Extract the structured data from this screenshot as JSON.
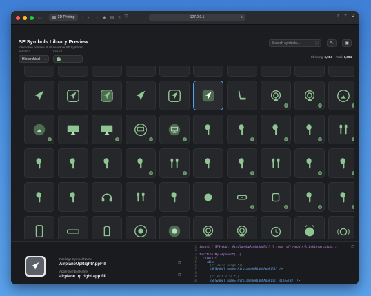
{
  "browser": {
    "tab_label": "3D Printing",
    "url": "127.0.0.1"
  },
  "app": {
    "title": "SF Symbols Library Preview",
    "subtitle": "Interactive preview of all available SF Symbols",
    "search_placeholder": "Search symbols...",
    "search_shortcut": "⌘K",
    "variant_label": "VARIANT",
    "variant_value": "Hierarchical",
    "color_label": "COLOR",
    "color_value": "#8fc592",
    "showing_label": "Showing:",
    "showing_count": "6,984",
    "total_label": "Total:",
    "total_count": "6,984"
  },
  "grid": {
    "rows": [
      [
        "airplane-icon",
        "airplane-circle-icon",
        "airplane-square-icon",
        "airplane-departure-icon",
        "airplane-arrival-icon",
        "airplane-tilt-icon",
        "airplane-tilt-icon",
        "airplane-tilt-icon",
        "airplane-tilt-icon",
        "airplane-tilt-icon"
      ],
      [
        "airplane-up-right-icon",
        "airplane-up-right-square-icon",
        "airplane-up-right-app-icon",
        "airplane-up-right-icon",
        "airplane-up-right-square-icon",
        "airplane-up-right-app-fill-icon",
        "seat-icon",
        "airplay-audio-icon",
        "airplay-audio-badge-icon",
        "airplay-audio-circle-icon"
      ],
      [
        "airplay-audio-circle-fill-icon",
        "airplay-video-icon",
        "airplay-video-badge-icon",
        "airplay-video-circle-icon",
        "airplay-video-circle-fill-icon",
        "airpod-left-icon",
        "airpod-right-icon",
        "airpod-gen3-left-icon",
        "airpod-gen3-right-icon",
        "airpods-icon"
      ],
      [
        "airpods-case-icon",
        "airpods-case-fill-icon",
        "airpods-chargingcase-icon",
        "airpods-chargingcase-fill-icon",
        "airpods-pro-icon",
        "airpods-pro-chargingcase-icon",
        "airpods-chargingcase-wireless-icon",
        "airpods-gen3-icon",
        "airpods-gen3-chargingcase-icon",
        "airpods-gen3-chargingcase-fill-icon"
      ],
      [
        "airpod-pro-left-icon",
        "airpod-pro-right-icon",
        "airpods-max-icon",
        "airpods-pro-pair-icon",
        "airpods-chargingcase-wireless-fill-icon",
        "airtag-icon",
        "airport-express-icon",
        "airport-extreme-icon",
        "airpod-gen3-right-icon",
        "airpod-gen3-right-icon"
      ],
      [
        "phone-icon",
        "appletv-remote-icon",
        "homepod-mini-icon",
        "applelogo-circle-icon",
        "applelogo-circle-fill-icon",
        "airplay-audio-icon",
        "airplay-audio-icon",
        "alarm-icon",
        "alarm-fill-icon",
        "alarm-waves-icon"
      ]
    ],
    "selected_index": 15,
    "info_badges": [
      17,
      18,
      19,
      20,
      22,
      23,
      24,
      26,
      27,
      28,
      29,
      33,
      34,
      36,
      38,
      39,
      46,
      47,
      48,
      49,
      55,
      56,
      57,
      59
    ]
  },
  "selected": {
    "package_label": "Package Symbol Name",
    "package_name": "AirplaneUpRightAppFill",
    "apple_label": "Apple Symbol Name",
    "apple_name": "airplane.up.right.app.fill"
  },
  "code_lines": [
    {
      "n": "1",
      "t": "import { SFSymbol, AirplaneUpRightAppFill } from 'sf-symbols-lib/hierarchical';"
    },
    {
      "n": "2",
      "t": ""
    },
    {
      "n": "3",
      "t": "function MyComponent() {"
    },
    {
      "n": "4",
      "t": "  return ("
    },
    {
      "n": "5",
      "t": "    <div>"
    },
    {
      "n": "6",
      "t": "      {/* Basic usage */}"
    },
    {
      "n": "7",
      "t": "      <SFSymbol name={AirplaneUpRightAppFill} />"
    },
    {
      "n": "8",
      "t": ""
    },
    {
      "n": "9",
      "t": "      {/* With size */}"
    },
    {
      "n": "10",
      "t": "      <SFSymbol name={AirplaneUpRightAppFill} size={32} />"
    }
  ]
}
